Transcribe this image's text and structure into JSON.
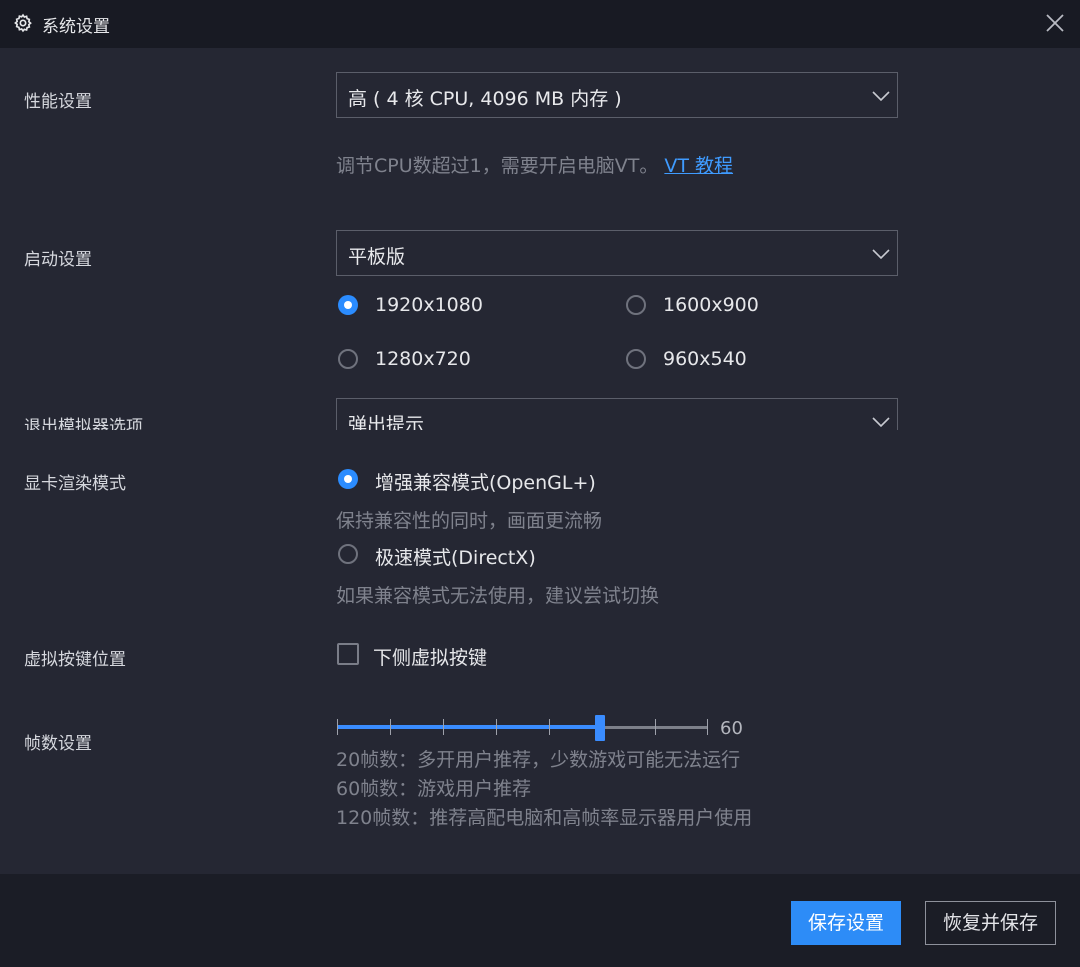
{
  "window": {
    "title": "系统设置",
    "icon": "gear-icon",
    "close_icon": "close-icon"
  },
  "performance": {
    "label": "性能设置",
    "selected": "高 ( 4 核 CPU, 4096 MB 内存 )",
    "hint": "调节CPU数超过1，需要开启电脑VT。",
    "hint_link": "VT 教程"
  },
  "startup": {
    "label": "启动设置",
    "selected": "平板版",
    "resolutions": [
      {
        "label": "1920x1080",
        "checked": true
      },
      {
        "label": "1600x900",
        "checked": false
      },
      {
        "label": "1280x720",
        "checked": false
      },
      {
        "label": "960x540",
        "checked": false
      }
    ]
  },
  "exit_option": {
    "label": "退出模拟器选项",
    "selected": "弹出提示"
  },
  "render_mode": {
    "label": "显卡渲染模式",
    "options": [
      {
        "label": "增强兼容模式(OpenGL+)",
        "desc": "保持兼容性的同时，画面更流畅",
        "checked": true
      },
      {
        "label": "极速模式(DirectX)",
        "desc": "如果兼容模式无法使用，建议尝试切换",
        "checked": false
      }
    ]
  },
  "virtual_keys": {
    "label": "虚拟按键位置",
    "checkbox_label": "下侧虚拟按键",
    "checked": false
  },
  "fps": {
    "label": "帧数设置",
    "value": "60",
    "level": 0.71,
    "notes": [
      "20帧数：多开用户推荐，少数游戏可能无法运行",
      "60帧数：游戏用户推荐",
      "120帧数：推荐高配电脑和高帧率显示器用户使用"
    ]
  },
  "footer": {
    "save_label": "保存设置",
    "restore_label": "恢复并保存"
  },
  "colors": {
    "accent": "#2d8cf7",
    "link": "#3f9bff",
    "background": "#252733",
    "titlebar": "#181a23"
  }
}
